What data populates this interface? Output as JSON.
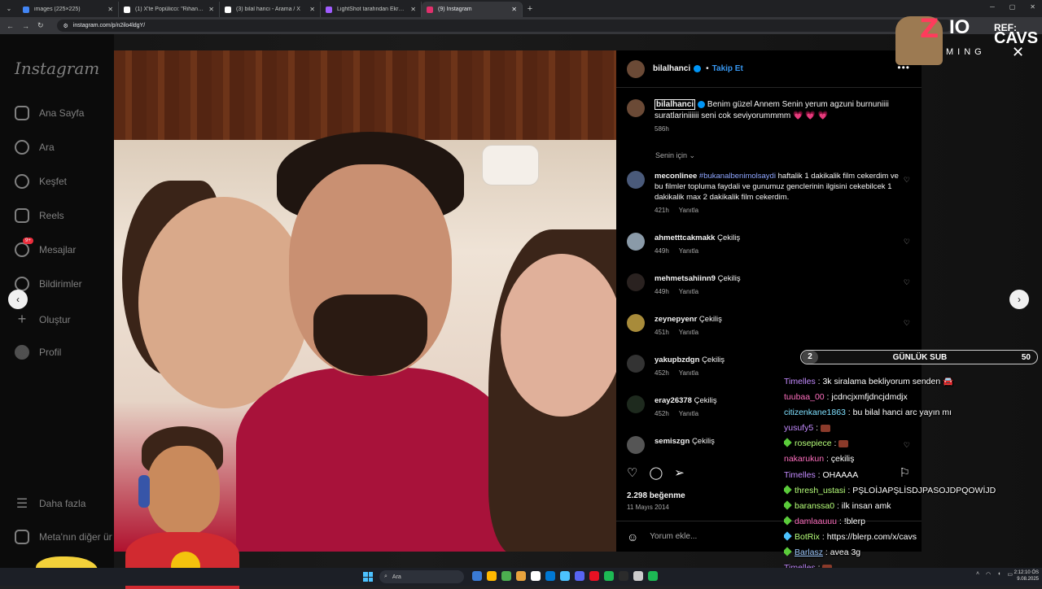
{
  "browser": {
    "tabs": [
      {
        "title": "images (225×225)",
        "favicon_color": "#4285f4",
        "active": false
      },
      {
        "title": "(1) X'te Popülicci: \"Rihanna, Lo...",
        "favicon_color": "#ffffff",
        "active": false
      },
      {
        "title": "(3) bilal hancı - Arama / X",
        "favicon_color": "#ffffff",
        "active": false
      },
      {
        "title": "LightShot tarafından Ekran Gö...",
        "favicon_color": "#a05cff",
        "active": false
      },
      {
        "title": "(9) Instagram",
        "favicon_color": "#e1306c",
        "active": true
      }
    ],
    "url": "instagram.com/p/n2ilo4ldgY/"
  },
  "instagram": {
    "logo": "Instagram",
    "nav": [
      {
        "label": "Ana Sayfa",
        "icon": "home-icon"
      },
      {
        "label": "Ara",
        "icon": "search-icon"
      },
      {
        "label": "Keşfet",
        "icon": "compass-icon"
      },
      {
        "label": "Reels",
        "icon": "reels-icon"
      },
      {
        "label": "Mesajlar",
        "icon": "messenger-icon",
        "badge": "9+"
      },
      {
        "label": "Bildirimler",
        "icon": "heart-icon"
      },
      {
        "label": "Oluştur",
        "icon": "plus-icon"
      },
      {
        "label": "Profil",
        "icon": "profile-icon"
      }
    ],
    "more": "Daha fazla",
    "meta": "Meta'nın diğer ür",
    "post": {
      "username": "bilalhanci",
      "follow": "Takip Et",
      "caption_user": "bilalhanci",
      "caption": "Benim güzel Annem Senin yerum agzuni burnuniiii suratlariniiiiii seni cok seviyorummmm 💗 💗 💗",
      "caption_age": "586h",
      "for_you": "Senin için",
      "likes": "2.298 beğenme",
      "date": "11 Mayıs 2014",
      "add_comment": "Yorum ekle...",
      "comments": [
        {
          "user": "meconlinee",
          "tag": "#bukanalbenimolsaydi",
          "text": " haftalik 1 dakikalik film cekerdim ve bu filmler topluma faydali ve gunumuz genclerinin ilgisini cekebilcek 1 dakikalik max 2 dakikalik film cekerdim.",
          "age": "421h",
          "reply": "Yanıtla"
        },
        {
          "user": "ahmetttcakmakk",
          "text": "Çekiliş",
          "age": "449h",
          "reply": "Yanıtla"
        },
        {
          "user": "mehmetsahiinn9",
          "text": "Çekiliş",
          "age": "449h",
          "reply": "Yanıtla"
        },
        {
          "user": "zeynepyenr",
          "text": "Çekiliş",
          "age": "451h",
          "reply": "Yanıtla"
        },
        {
          "user": "yakupbzdgn",
          "text": "Çekiliş",
          "age": "452h",
          "reply": "Yanıtla"
        },
        {
          "user": "eray26378",
          "text": "Çekiliş",
          "age": "452h",
          "reply": "Yanıtla"
        },
        {
          "user": "semiszgn",
          "text": "Çekiliş",
          "age": "",
          "reply": ""
        }
      ]
    }
  },
  "overlay": {
    "brand_z": "Z",
    "brand_io": "IO",
    "brand_ming": "MING",
    "ref_label": "REF:",
    "ref_code": "CAVS",
    "sub_left": "2",
    "sub_label": "GÜNLÜK SUB",
    "sub_right": "50",
    "chat": [
      {
        "user": "Timelles",
        "msg": " : 3k siralama bekliyorum senden 🚘"
      },
      {
        "user": "tuubaa_00",
        "msg": " : jcdncjxmfjdncjdmdjx"
      },
      {
        "user": "citizenkane1863",
        "msg": " : bu bilal hanci arc yayın mı"
      },
      {
        "user": "yusufy5",
        "msg": " : "
      },
      {
        "user": "rosepiece",
        "msg": " : "
      },
      {
        "user": "nakarukun",
        "msg": " : çekiliş"
      },
      {
        "user": "Timelles",
        "msg": " : OHAAAA"
      },
      {
        "user": "thresh_ustasi",
        "msg": " : PŞLOİJAPŞLİSDJPASOJDPQOWİJD"
      },
      {
        "user": "baranssa0",
        "msg": " : ilk insan amk"
      },
      {
        "user": "damlaauuu",
        "msg": " : !blerp"
      },
      {
        "user": "BotRix",
        "msg": " : https://blerp.com/x/cavs"
      },
      {
        "user": "Barlasz",
        "msg": " : avea 3g"
      },
      {
        "user": "Timelles",
        "msg": " : "
      }
    ]
  },
  "taskbar": {
    "search": "Ara",
    "time": "2:12:10 ÖS",
    "date": "9.08.2025"
  }
}
